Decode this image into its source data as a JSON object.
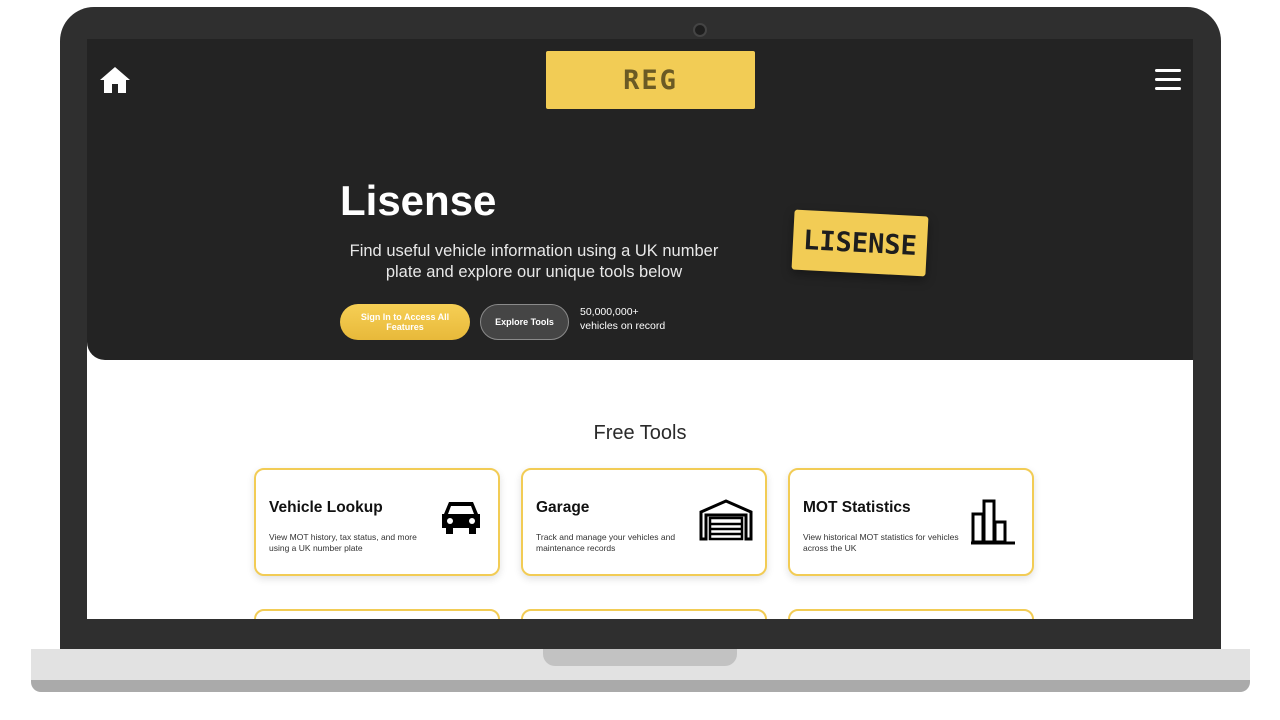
{
  "header": {
    "logo_text": "REG"
  },
  "hero": {
    "title": "Lisense",
    "subtitle": "Find useful vehicle information using a UK number plate and explore our unique tools below",
    "signin_label": "Sign In to Access All Features",
    "explore_label": "Explore Tools",
    "stat_value": "50,000,000+",
    "stat_label": "vehicles on record",
    "plate_text": "LISENSE"
  },
  "tools": {
    "section_title": "Free Tools",
    "cards": [
      {
        "title": "Vehicle Lookup",
        "description": "View MOT history, tax status, and more using a UK number plate",
        "icon": "car-icon"
      },
      {
        "title": "Garage",
        "description": "Track and manage your vehicles and maintenance records",
        "icon": "garage-icon"
      },
      {
        "title": "MOT Statistics",
        "description": "View historical MOT statistics for vehicles across the UK",
        "icon": "bar-chart-icon"
      }
    ]
  },
  "colors": {
    "accent": "#f2cc55",
    "hero_bg": "#232323",
    "frame": "#2f2f2f"
  }
}
